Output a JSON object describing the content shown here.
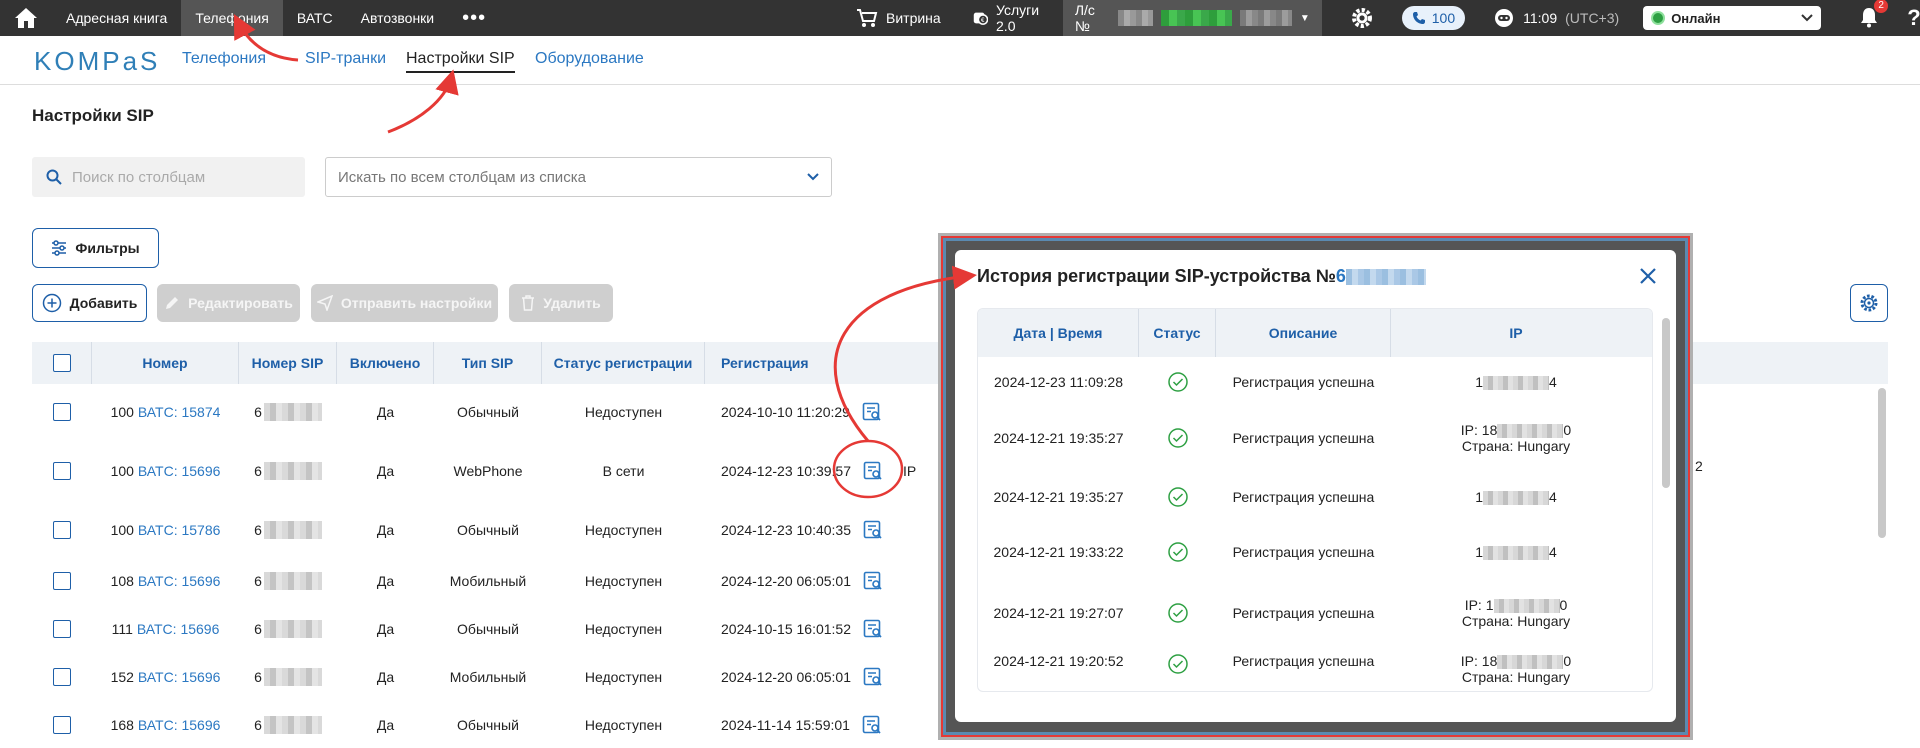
{
  "topbar": {
    "nav": [
      "Адресная книга",
      "Телефония",
      "ВАТС",
      "Автозвонки"
    ],
    "active_nav": "Телефония",
    "vitrina": "Витрина",
    "services": "Услуги 2.0",
    "account_prefix": "Л/с №",
    "phone_count": "100",
    "time": "11:09",
    "timezone": "(UTC+3)",
    "status": "Онлайн",
    "notifications": "2",
    "help": "?"
  },
  "logo": "KOMPaS",
  "subnav": [
    "Телефония",
    "SIP-транки",
    "Настройки SIP",
    "Оборудование"
  ],
  "page": {
    "title": "Настройки SIP",
    "search_placeholder": "Поиск по столбцам",
    "select_placeholder": "Искать по всем столбцам из списка",
    "filters": "Фильтры",
    "add": "Добавить",
    "edit": "Редактировать",
    "send": "Отправить настройки",
    "delete": "Удалить"
  },
  "table": {
    "headers": [
      "Номер",
      "Номер SIP",
      "Включено",
      "Тип SIP",
      "Статус регистрации",
      "Регистрация"
    ],
    "rows": [
      {
        "num": "100",
        "vats": "ВАТС: 15874",
        "sip": "6",
        "enabled": "Да",
        "type": "Обычный",
        "status": "Недоступен",
        "reg": "2024-10-10 11:20:29"
      },
      {
        "num": "100",
        "vats": "ВАТС: 15696",
        "sip": "6",
        "enabled": "Да",
        "type": "WebPhone",
        "status": "В сети",
        "reg": "2024-12-23 10:39:57"
      },
      {
        "num": "100",
        "vats": "ВАТС: 15786",
        "sip": "6",
        "enabled": "Да",
        "type": "Обычный",
        "status": "Недоступен",
        "reg": "2024-12-23 10:40:35"
      },
      {
        "num": "108",
        "vats": "ВАТС: 15696",
        "sip": "6",
        "enabled": "Да",
        "type": "Мобильный",
        "status": "Недоступен",
        "reg": "2024-12-20 06:05:01"
      },
      {
        "num": "111",
        "vats": "ВАТС: 15696",
        "sip": "6",
        "enabled": "Да",
        "type": "Обычный",
        "status": "Недоступен",
        "reg": "2024-10-15 16:01:52"
      },
      {
        "num": "152",
        "vats": "ВАТС: 15696",
        "sip": "6",
        "enabled": "Да",
        "type": "Мобильный",
        "status": "Недоступен",
        "reg": "2024-12-20 06:05:01"
      },
      {
        "num": "168",
        "vats": "ВАТС: 15696",
        "sip": "6",
        "enabled": "Да",
        "type": "Обычный",
        "status": "Недоступен",
        "reg": "2024-11-14 15:59:01"
      }
    ],
    "row2_ip_prefix": "IP",
    "row2_tail": "2"
  },
  "modal": {
    "title": "История регистрации SIP-устройства №",
    "number_prefix": "6",
    "headers": [
      "Дата | Время",
      "Статус",
      "Описание",
      "IP"
    ],
    "rows": [
      {
        "dt": "2024-12-23 11:09:28",
        "desc": "Регистрация успешна",
        "ip_a": "1",
        "ip_b": "4",
        "country": ""
      },
      {
        "dt": "2024-12-21 19:35:27",
        "desc": "Регистрация успешна",
        "ip_a": "IP: 18",
        "ip_b": "0",
        "country": "Страна: Hungary"
      },
      {
        "dt": "2024-12-21 19:35:27",
        "desc": "Регистрация успешна",
        "ip_a": "1",
        "ip_b": "4",
        "country": ""
      },
      {
        "dt": "2024-12-21 19:33:22",
        "desc": "Регистрация успешна",
        "ip_a": "1",
        "ip_b": "4",
        "country": ""
      },
      {
        "dt": "2024-12-21 19:27:07",
        "desc": "Регистрация успешна",
        "ip_a": "IP: 1",
        "ip_b": "0",
        "country": "Страна: Hungary"
      },
      {
        "dt": "2024-12-21 19:20:52",
        "desc": "Регистрация успешна",
        "ip_a": "IP: 18",
        "ip_b": "0",
        "country": "Страна: Hungary"
      }
    ]
  },
  "colors": {
    "accent": "#1e5fa8",
    "link": "#2b78c2",
    "topbar": "#333333",
    "success": "#2ea043",
    "annotation": "#e53935"
  }
}
